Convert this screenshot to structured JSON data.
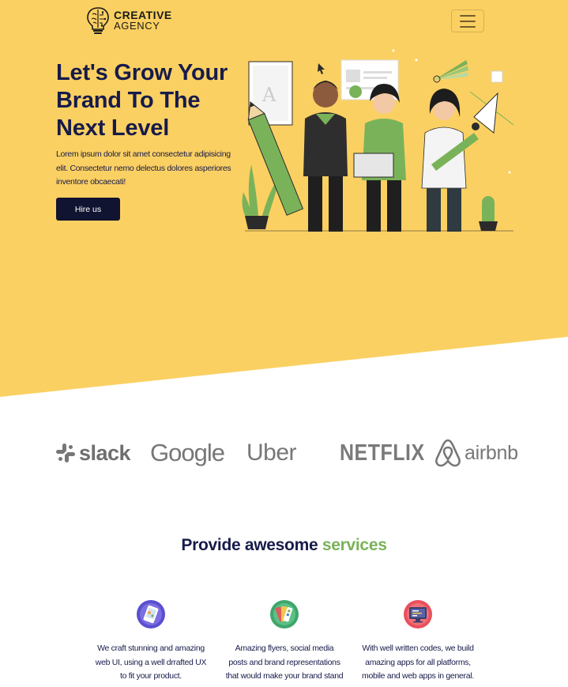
{
  "navbar": {
    "brand_line1": "CREATIVE",
    "brand_line2": "AGENCY",
    "brand_icon": "brain-bulb-icon",
    "menu_icon": "hamburger-menu-icon"
  },
  "hero": {
    "title_line1": "Let's Grow Your",
    "title_line2": "Brand To The",
    "title_line3": "Next Level",
    "description": "Lorem ipsum dolor sit amet consectetur adipisicing elit. Consectetur nemo delectus dolores asperiores inventore obcaecati!",
    "cta_label": "Hire us",
    "illustration": "team-illustration",
    "background_color": "#fbd062"
  },
  "clients": {
    "logos": [
      {
        "name": "slack",
        "label": "slack",
        "icon": "slack-logo"
      },
      {
        "name": "google",
        "label": "Google",
        "icon": "google-logo"
      },
      {
        "name": "uber",
        "label": "Uber",
        "icon": "uber-logo"
      },
      {
        "name": "netflix",
        "label": "NETFLIX",
        "icon": "netflix-logo"
      },
      {
        "name": "airbnb",
        "label": "airbnb",
        "icon": "airbnb-logo"
      }
    ]
  },
  "services": {
    "heading_prefix": "Provide awesome",
    "heading_accent": "services",
    "accent_color": "#7ab259",
    "items": [
      {
        "icon": "mobile-design-icon",
        "text": "We craft stunning and amazing web UI, using a well drrafted UX to fit your product."
      },
      {
        "icon": "color-palette-icon",
        "text": "Amazing flyers, social media posts and brand representations that would make your brand stand out."
      },
      {
        "icon": "code-monitor-icon",
        "text": "With well written codes, we build amazing apps for all platforms, mobile and web apps in general."
      }
    ]
  },
  "colors": {
    "dark_navy": "#171b4a",
    "button_bg": "#111430"
  }
}
